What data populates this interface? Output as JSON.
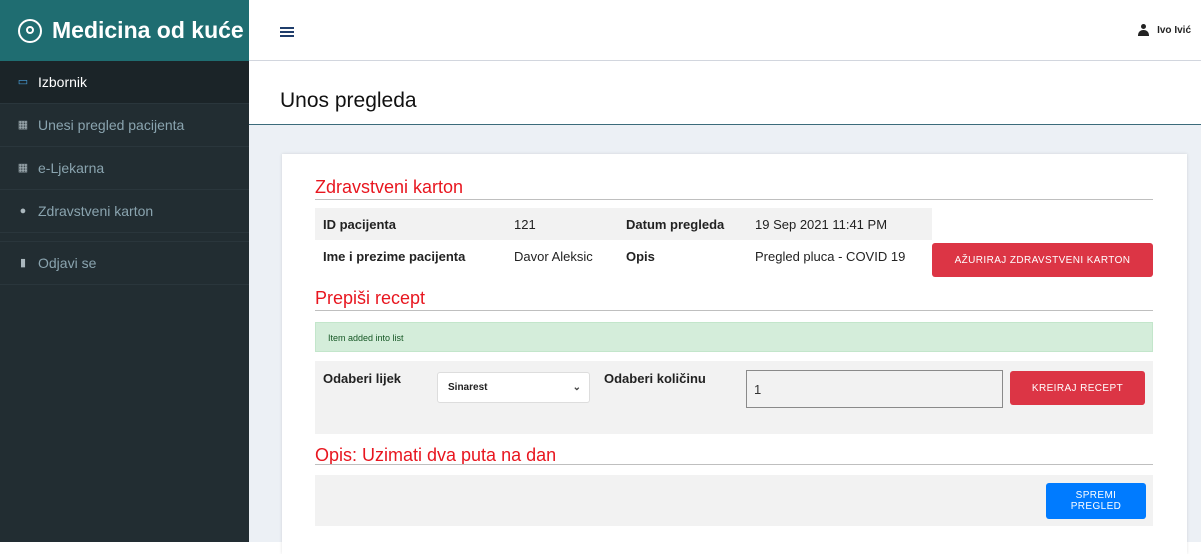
{
  "brand": {
    "title": "Medicina od kuće"
  },
  "sidebar": {
    "items": [
      {
        "label": "Izbornik",
        "icon": "monitor-icon"
      },
      {
        "label": "Unesi pregled pacijenta",
        "icon": "grid-icon"
      },
      {
        "label": "e-Ljekarna",
        "icon": "grid-icon"
      },
      {
        "label": "Zdravstveni karton",
        "icon": "car-icon"
      },
      {
        "label": "Odjavi se",
        "icon": "file-icon"
      }
    ]
  },
  "topbar": {
    "user_name": "Ivo Ivić",
    "user_icon": "user-icon",
    "menu_icon": "hamburger-icon"
  },
  "page": {
    "title": "Unos pregleda"
  },
  "record": {
    "section_title": "Zdravstveni karton",
    "id_label": "ID pacijenta",
    "id_value": "121",
    "date_label": "Datum pregleda",
    "date_value": "19 Sep 2021 11:41 PM",
    "name_label": "Ime i prezime pacijenta",
    "name_value": "Davor Aleksic",
    "desc_label": "Opis",
    "desc_value": "Pregled pluca - COVID 19",
    "update_button": "AŽURIRAJ ZDRAVSTVENI KARTON"
  },
  "prescription": {
    "section_title": "Prepiši recept",
    "alert": "Item added into list",
    "drug_label": "Odaberi lijek",
    "drug_selected": "Sinarest",
    "qty_label": "Odaberi količinu",
    "qty_value": "1",
    "create_button": "KREIRAJ RECEPT"
  },
  "note": {
    "title": "Opis: Uzimati dva puta na dan",
    "save_button": "SPREMI PREGLED"
  },
  "colors": {
    "brand": "#1f6d71",
    "sidebar": "#222d32",
    "danger": "#dc3545",
    "primary": "#007bff",
    "heading": "#e8161f"
  }
}
